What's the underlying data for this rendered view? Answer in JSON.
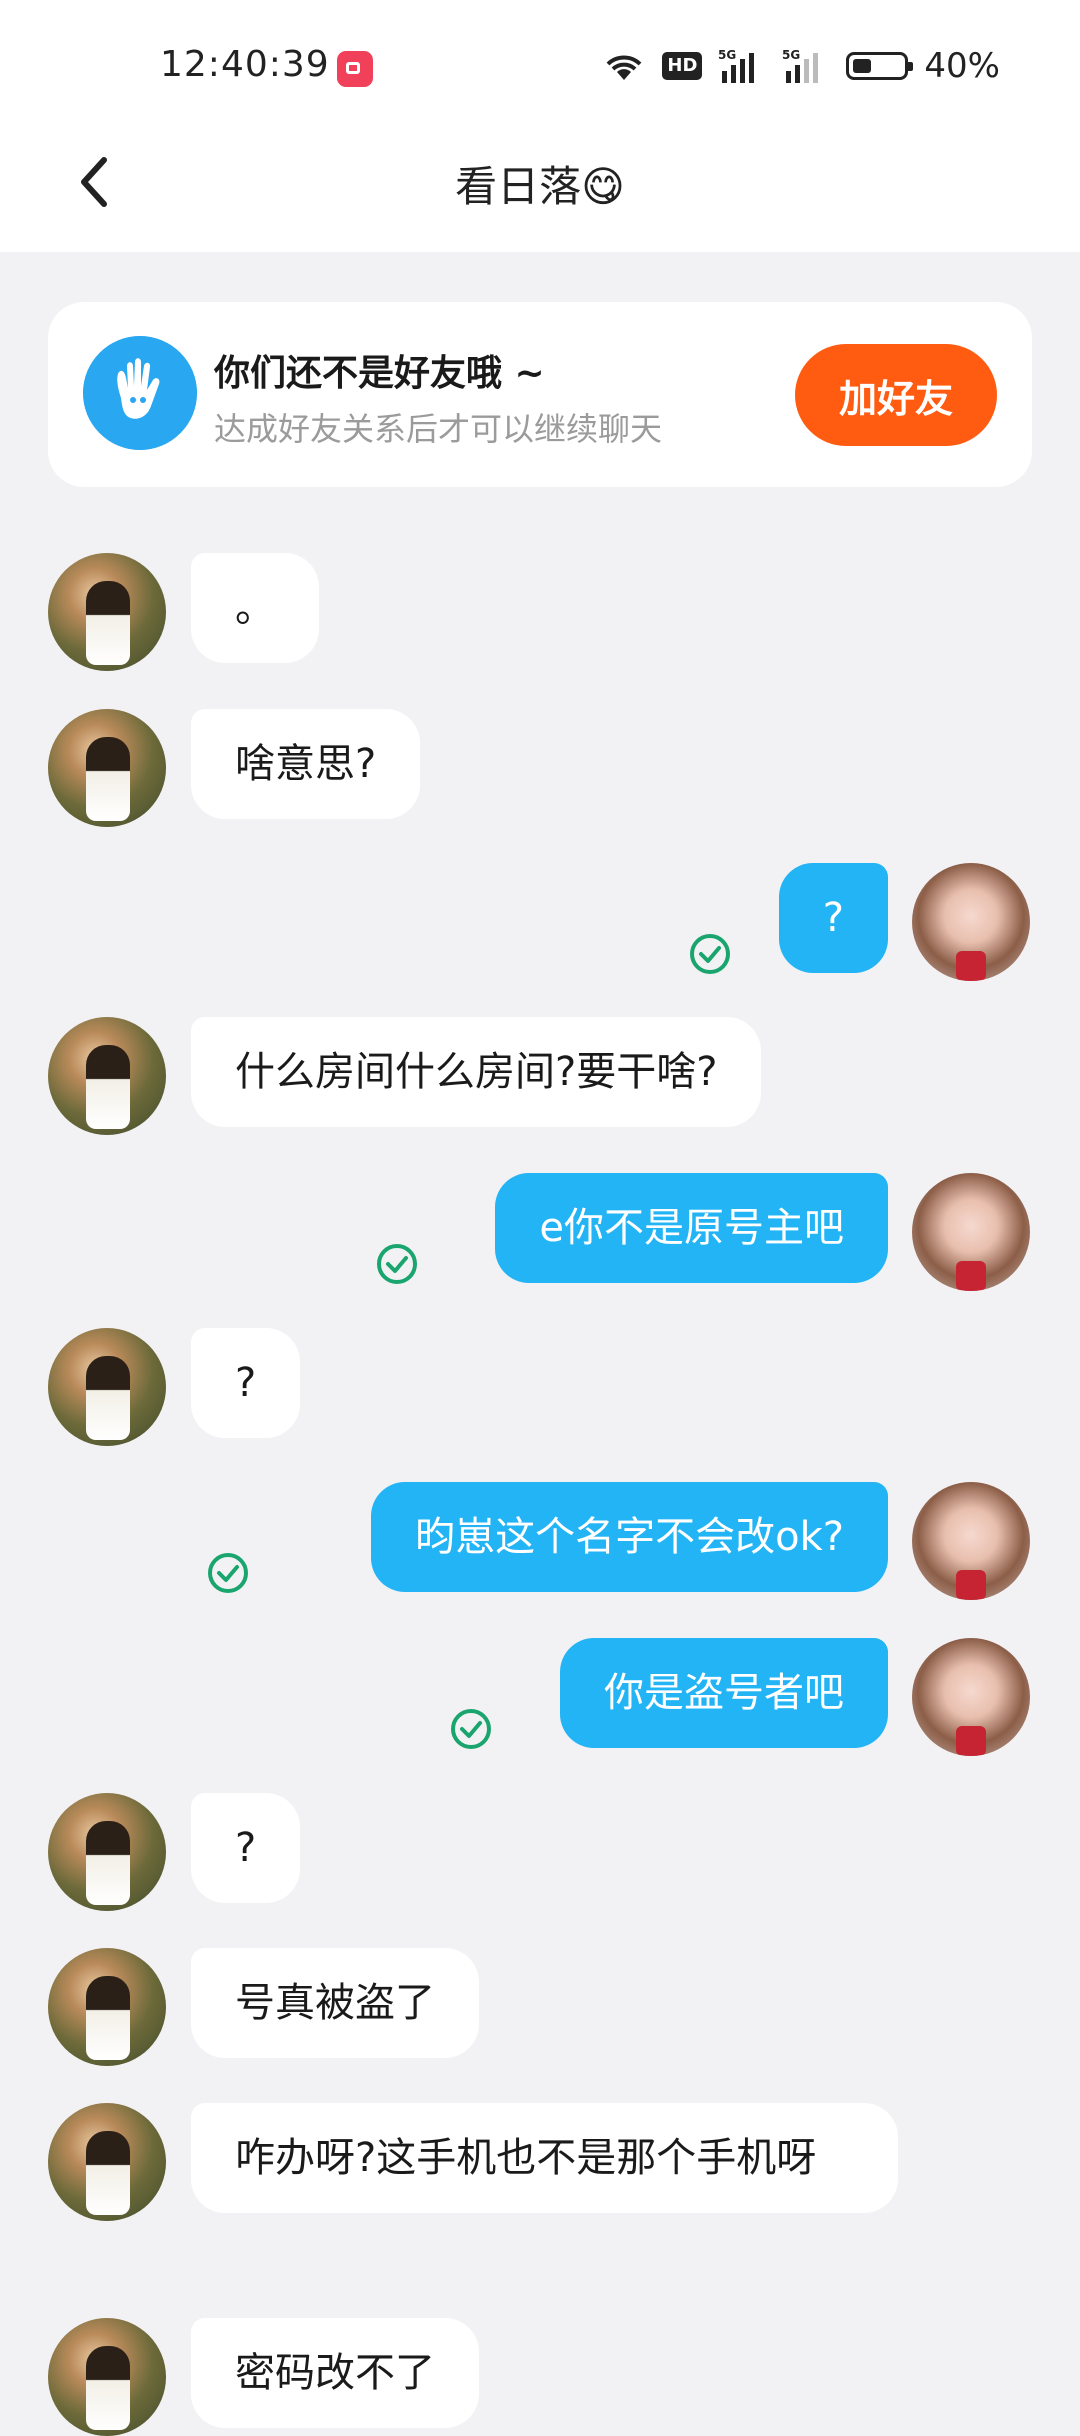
{
  "status_bar": {
    "time": "12:40:39",
    "network": "5G",
    "hd_label": "HD",
    "battery": "40%"
  },
  "header": {
    "title": "看日落😋"
  },
  "notice": {
    "title": "你们还不是好友哦 ~",
    "subtitle": "达成好友关系后才可以继续聊天",
    "button": "加好友"
  },
  "colors": {
    "accent": "#22b4f5",
    "add_button": "#ff5b11",
    "read_check": "#1aa56e"
  },
  "messages": [
    {
      "from": "other",
      "text": "。"
    },
    {
      "from": "other",
      "text": "啥意思?"
    },
    {
      "from": "me",
      "text": "?",
      "read": true
    },
    {
      "from": "other",
      "text": "什么房间什么房间?要干啥?"
    },
    {
      "from": "me",
      "text": "e你不是原号主吧",
      "read": true
    },
    {
      "from": "other",
      "text": "?"
    },
    {
      "from": "me",
      "text": "昀崽这个名字不会改ok?",
      "read": true
    },
    {
      "from": "me",
      "text": "你是盗号者吧",
      "read": true
    },
    {
      "from": "other",
      "text": "?"
    },
    {
      "from": "other",
      "text": "号真被盗了"
    },
    {
      "from": "other",
      "text": "咋办呀?这手机也不是那个手机呀"
    },
    {
      "from": "other",
      "text": "密码改不了"
    }
  ]
}
